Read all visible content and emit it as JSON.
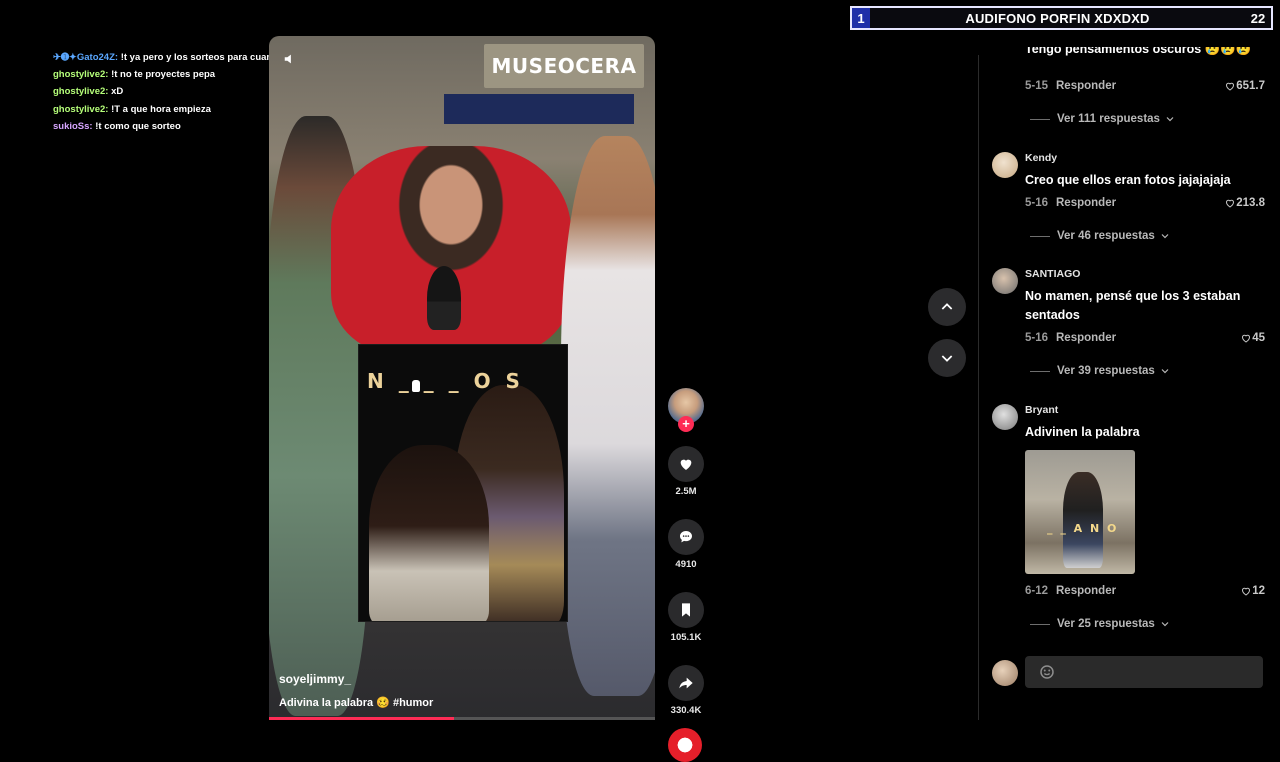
{
  "banner": {
    "rank": "1",
    "title": "AUDIFONO PORFIN XDXDXD",
    "count": "22",
    "accent": "#1f2fa8"
  },
  "chat": [
    {
      "user": "✈➊✦Gato24Z:",
      "message": "!t ya pero y los sorteos para cuando?",
      "color": "#5aa7ff"
    },
    {
      "user": "ghostylive2:",
      "message": "!t no te proyectes pepa",
      "color": "#b6ff7a"
    },
    {
      "user": "ghostylive2:",
      "message": "xD",
      "color": "#b6ff7a"
    },
    {
      "user": "ghostylive2:",
      "message": "!T a que hora empieza",
      "color": "#b6ff7a"
    },
    {
      "user": "sukioSs:",
      "message": "!t como que sorteo",
      "color": "#d7a6ff"
    }
  ],
  "video": {
    "sign_text": "MUSEOCERA",
    "overlay_word": "N _ _ _ O S",
    "handle": "soyeljimmy_",
    "caption": "Adivina la palabra 🥴 #humor",
    "progress": 0.48
  },
  "actions": {
    "likes": "2.5M",
    "comments": "4910",
    "saves": "105.1K",
    "shares": "330.4K",
    "follow_symbol": "+"
  },
  "comments": [
    {
      "name": "",
      "text": "Tengo pensamientos oscuros 😢😢😢",
      "date": "5-15",
      "reply": "Responder",
      "likes": "651.7",
      "more": "Ver 111 respuestas",
      "avatar_color": "#888"
    },
    {
      "name": "Kendy",
      "text": "Creo que ellos eran fotos jajajajaja",
      "date": "5-16",
      "reply": "Responder",
      "likes": "213.8",
      "more": "Ver 46 respuestas",
      "avatar_color": "#d9c4a4"
    },
    {
      "name": "SANTIAGO",
      "text": "No mamen, pensé que los 3 estaban sentados",
      "date": "5-16",
      "reply": "Responder",
      "likes": "45",
      "more": "Ver 39 respuestas",
      "avatar_color": "#8f8f8f"
    },
    {
      "name": "Bryant",
      "text": "Adivinen la palabra",
      "thumb_word": "_ _ A N O",
      "date": "6-12",
      "reply": "Responder",
      "likes": "12",
      "more": "Ver 25 respuestas",
      "avatar_color": "#a6a6a6"
    }
  ],
  "icons": {
    "mute": "speaker-muted-icon",
    "like": "heart-icon",
    "comment": "chat-bubble-icon",
    "save": "bookmark-icon",
    "share": "share-arrow-icon",
    "up": "chevron-up-icon",
    "down": "chevron-down-icon",
    "emoji": "emoji-icon"
  }
}
